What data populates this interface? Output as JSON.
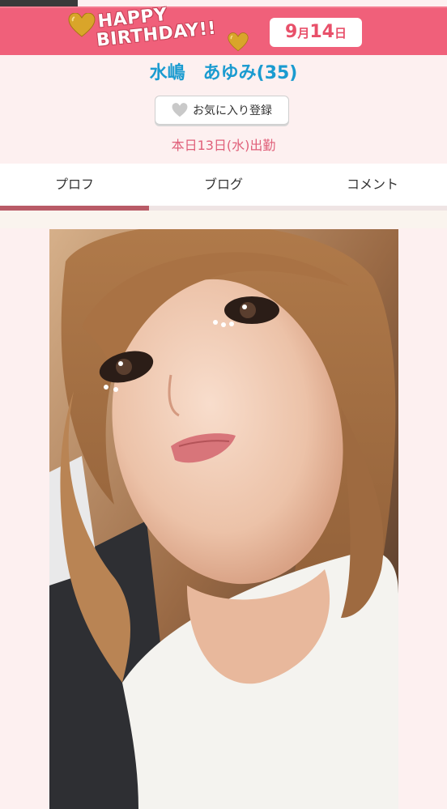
{
  "banner": {
    "line1": "HAPPY",
    "line2": "BIRTHDAY!!",
    "date_month": "9",
    "date_month_unit": "月",
    "date_day": "14",
    "date_day_unit": "日"
  },
  "profile": {
    "name": "水嶋　あゆみ",
    "age": "(35)",
    "favorite_label": "お気に入り登録",
    "shift_text": "本日13日(水)出勤"
  },
  "tabs": [
    {
      "label": "プロフ"
    },
    {
      "label": "ブログ"
    },
    {
      "label": "コメント"
    }
  ],
  "colors": {
    "banner": "#f0607a",
    "name": "#1a9bd0",
    "shift": "#e0607a",
    "tab_active": "#b95b67",
    "page_bg": "#fdf0f0"
  }
}
